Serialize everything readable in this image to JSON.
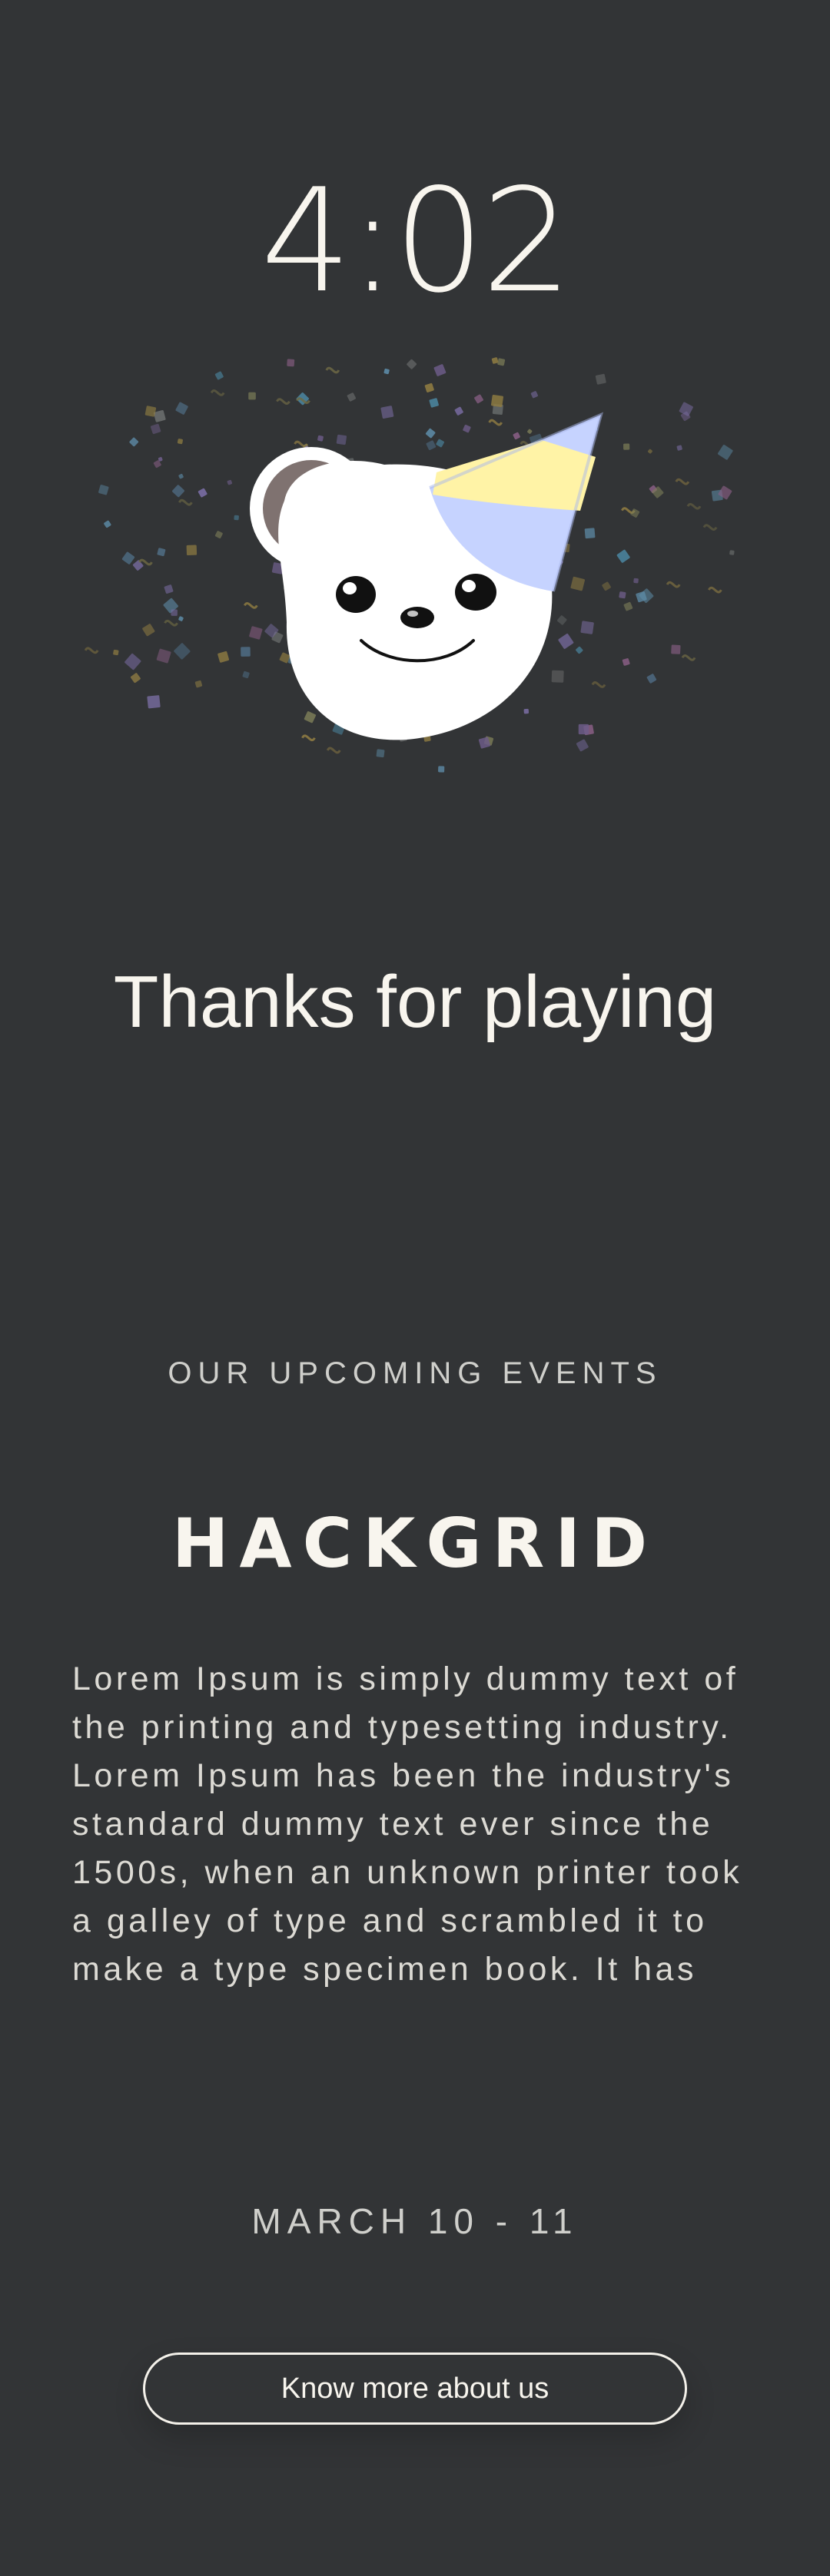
{
  "clock": {
    "time": "4:02"
  },
  "hero": {
    "mascot_icon": "party-bear-icon",
    "hat_colors": [
      "#c6d3ff",
      "#fff3a6"
    ],
    "ear_color": "#7f7270",
    "face_color": "#ffffff"
  },
  "headline": "Thanks for playing",
  "events": {
    "section_label": "OUR UPCOMING EVENTS",
    "name": "HACKGRID",
    "description": "Lorem Ipsum is simply dummy text of the printing and typesetting industry. Lorem Ipsum has been the industry's standard dummy text ever since the 1500s, when an unknown printer took a galley of type and scrambled it to make a type specimen book. It has",
    "date": "MARCH 10 - 11"
  },
  "cta": {
    "label": "Know more about us"
  },
  "theme": {
    "background": "#323436",
    "text": "#f8f5ee",
    "muted_text": "#cfcfcb"
  }
}
